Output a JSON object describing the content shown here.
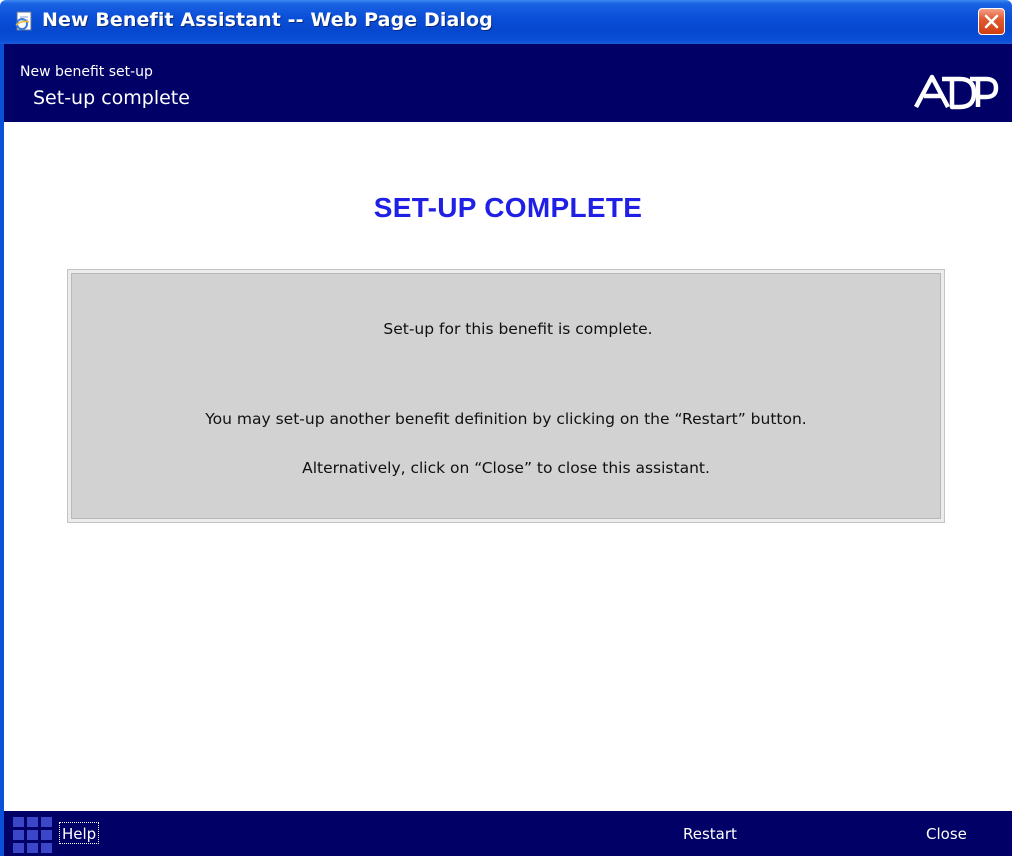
{
  "window": {
    "title": "New Benefit Assistant -- Web Page Dialog",
    "title_icon": "ie-page-icon",
    "close_icon": "close-icon"
  },
  "header": {
    "step_group": "New benefit set-up",
    "step_title": "Set-up complete",
    "logo": "adp-logo"
  },
  "main": {
    "heading": "SET-UP COMPLETE",
    "messages": [
      "Set-up for this benefit is complete.",
      "You may set-up another benefit definition by clicking on the “Restart” button.",
      "Alternatively, click on “Close” to close this assistant."
    ]
  },
  "footer": {
    "grid_icon": "grid-icon",
    "help_label": "Help",
    "restart_label": "Restart",
    "close_label": "Close"
  },
  "colors": {
    "titlebar": "#0a4fd8",
    "header_bg": "#000066",
    "heading": "#1f1fe6",
    "message_box_bg": "#d2d2d2"
  }
}
